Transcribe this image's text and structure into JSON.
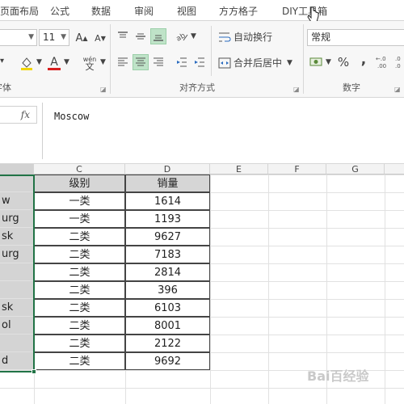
{
  "menu_tabs": [
    "页面布局",
    "公式",
    "数据",
    "审阅",
    "视图",
    "方方格子",
    "DIY工具箱"
  ],
  "ribbon": {
    "font_size": "11",
    "number_format": "常规",
    "wrap_text_label": "自动换行",
    "merge_center_label": "合并后居中",
    "group_font_label": "字体",
    "group_alignment_label": "对齐方式",
    "group_number_label": "数字",
    "wen_glyph": "wén",
    "wen_glyph2": "文",
    "percent_glyph": "%",
    "comma_glyph": ","
  },
  "formula_bar": {
    "fx_label": "fx",
    "formula_value": "Moscow"
  },
  "columns": [
    "C",
    "D",
    "E",
    "F",
    "G"
  ],
  "table": {
    "headers": [
      "级别",
      "销量"
    ],
    "rows": [
      {
        "a": "w",
        "level": "一类",
        "sales": "1614"
      },
      {
        "a": "urg",
        "level": "一类",
        "sales": "1193"
      },
      {
        "a": "sk",
        "level": "二类",
        "sales": "9627"
      },
      {
        "a": "urg",
        "level": "二类",
        "sales": "7183"
      },
      {
        "a": "",
        "level": "二类",
        "sales": "2814"
      },
      {
        "a": "",
        "level": "二类",
        "sales": "396"
      },
      {
        "a": "sk",
        "level": "二类",
        "sales": "6103"
      },
      {
        "a": "ol",
        "level": "二类",
        "sales": "8001"
      },
      {
        "a": "",
        "level": "二类",
        "sales": "2122"
      },
      {
        "a": "d",
        "level": "二类",
        "sales": "9692"
      }
    ]
  },
  "watermark": "Bai百经验",
  "colors": {
    "accent": "#217346",
    "highlight": "#bfe3c8",
    "header_fill": "#d6d6d6"
  }
}
